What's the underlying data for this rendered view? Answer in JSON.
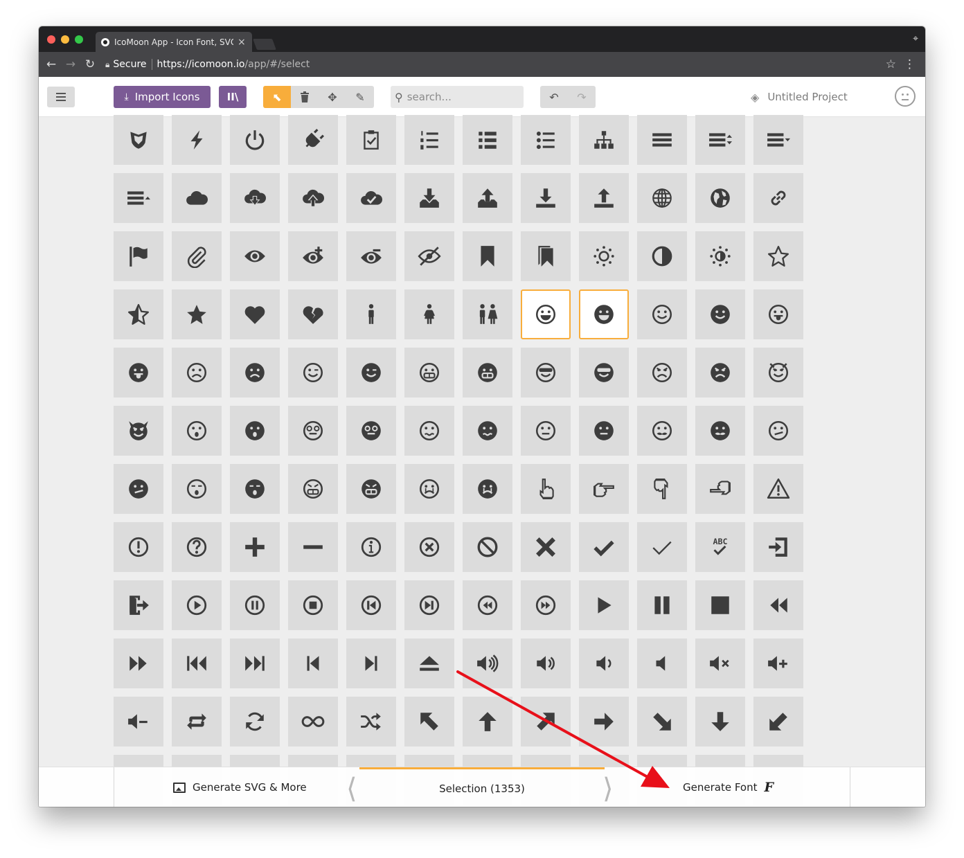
{
  "browser": {
    "tab_title": "IcoMoon App - Icon Font, SVG, PDF & PNG Generator",
    "tab_close": "×",
    "secure_label": "Secure",
    "url_host": "https://icomoon.io",
    "url_path": "/app/#/select"
  },
  "toolbar": {
    "import_label": "Import Icons",
    "search_placeholder": "search...",
    "project_name": "Untitled Project"
  },
  "bottom_bar": {
    "generate_svg_label": "Generate SVG & More",
    "selection_label": "Selection (1353)",
    "generate_font_label": "Generate Font",
    "font_icon_glyph": "F"
  },
  "colors": {
    "accent_purple": "#7b5a95",
    "accent_orange": "#f8ad3b",
    "annotation_red": "#e8101a"
  },
  "icon_grid": {
    "selected_cells": [
      [
        3,
        7
      ],
      [
        3,
        8
      ]
    ],
    "rows": [
      [
        "shield-icon",
        "power-icon-lightning",
        "switch-icon",
        "power-cord-icon",
        "clipboard-check-icon",
        "list-numbered-icon",
        "list-icon",
        "list-bullets-icon",
        "tree-icon",
        "menu-icon",
        "menu-sort-icon",
        "menu-down-icon"
      ],
      [
        "menu-up-icon",
        "cloud-icon",
        "cloud-download-icon",
        "cloud-upload-icon",
        "cloud-check-icon",
        "download-tray-icon",
        "upload-tray-icon",
        "download-icon",
        "upload-icon",
        "globe-icon",
        "earth-icon",
        "link-icon"
      ],
      [
        "flag-icon",
        "attachment-icon",
        "eye-icon",
        "eye-plus-icon",
        "eye-minus-icon",
        "eye-blocked-icon",
        "bookmark-icon",
        "bookmarks-icon",
        "sun-icon",
        "contrast-icon",
        "brightness-icon",
        "star-empty-icon"
      ],
      [
        "star-half-icon",
        "star-full-icon",
        "heart-icon",
        "heart-broken-icon",
        "man-icon",
        "woman-icon",
        "man-woman-icon",
        "happy-icon",
        "happy-filled-icon",
        "smile-icon",
        "smile-filled-icon",
        "tongue-icon"
      ],
      [
        "tongue-filled-icon",
        "sad-icon",
        "sad-filled-icon",
        "wink-icon",
        "wink-filled-icon",
        "grin-icon",
        "grin-filled-icon",
        "cool-icon",
        "cool-filled-icon",
        "angry-icon",
        "angry-filled-icon",
        "evil-icon"
      ],
      [
        "evil-filled-icon",
        "shocked-icon",
        "shocked-filled-icon",
        "baffled-icon",
        "baffled-filled-icon",
        "confused-icon",
        "confused-filled-icon",
        "neutral-icon",
        "neutral-filled-icon",
        "hipster-icon",
        "hipster-filled-icon",
        "wondering-icon"
      ],
      [
        "wondering-filled-icon",
        "sleepy-icon",
        "sleepy-filled-icon",
        "frustrated-icon",
        "frustrated-filled-icon",
        "crying-icon",
        "crying-filled-icon",
        "point-up-icon",
        "point-right-icon",
        "point-down-icon",
        "point-left-icon",
        "warning-icon"
      ],
      [
        "notification-icon",
        "question-icon",
        "plus-icon",
        "minus-icon",
        "info-icon",
        "cancel-circle-icon",
        "blocked-icon",
        "cross-icon",
        "checkmark-icon",
        "checkmark-thin-icon",
        "spell-check-icon",
        "enter-icon"
      ],
      [
        "exit-icon",
        "play-circle-icon",
        "pause-circle-icon",
        "stop-circle-icon",
        "previous-circle-icon",
        "next-circle-icon",
        "backward-circle-icon",
        "forward-circle-icon",
        "play-icon",
        "pause-icon",
        "stop-icon",
        "backward-icon"
      ],
      [
        "forward-icon",
        "first-icon",
        "last-icon",
        "previous-icon",
        "next-icon",
        "eject-icon",
        "volume-high-icon",
        "volume-medium-icon",
        "volume-low-icon",
        "volume-mute-icon",
        "volume-mute-x-icon",
        "volume-increase-icon"
      ],
      [
        "volume-decrease-icon",
        "loop-icon",
        "loop-circle-icon",
        "infinite-icon",
        "shuffle-icon",
        "arrow-up-left-icon",
        "arrow-up-icon",
        "arrow-up-right-icon",
        "arrow-right-icon",
        "arrow-down-right-icon",
        "arrow-down-icon",
        "arrow-down-left-icon"
      ]
    ]
  }
}
